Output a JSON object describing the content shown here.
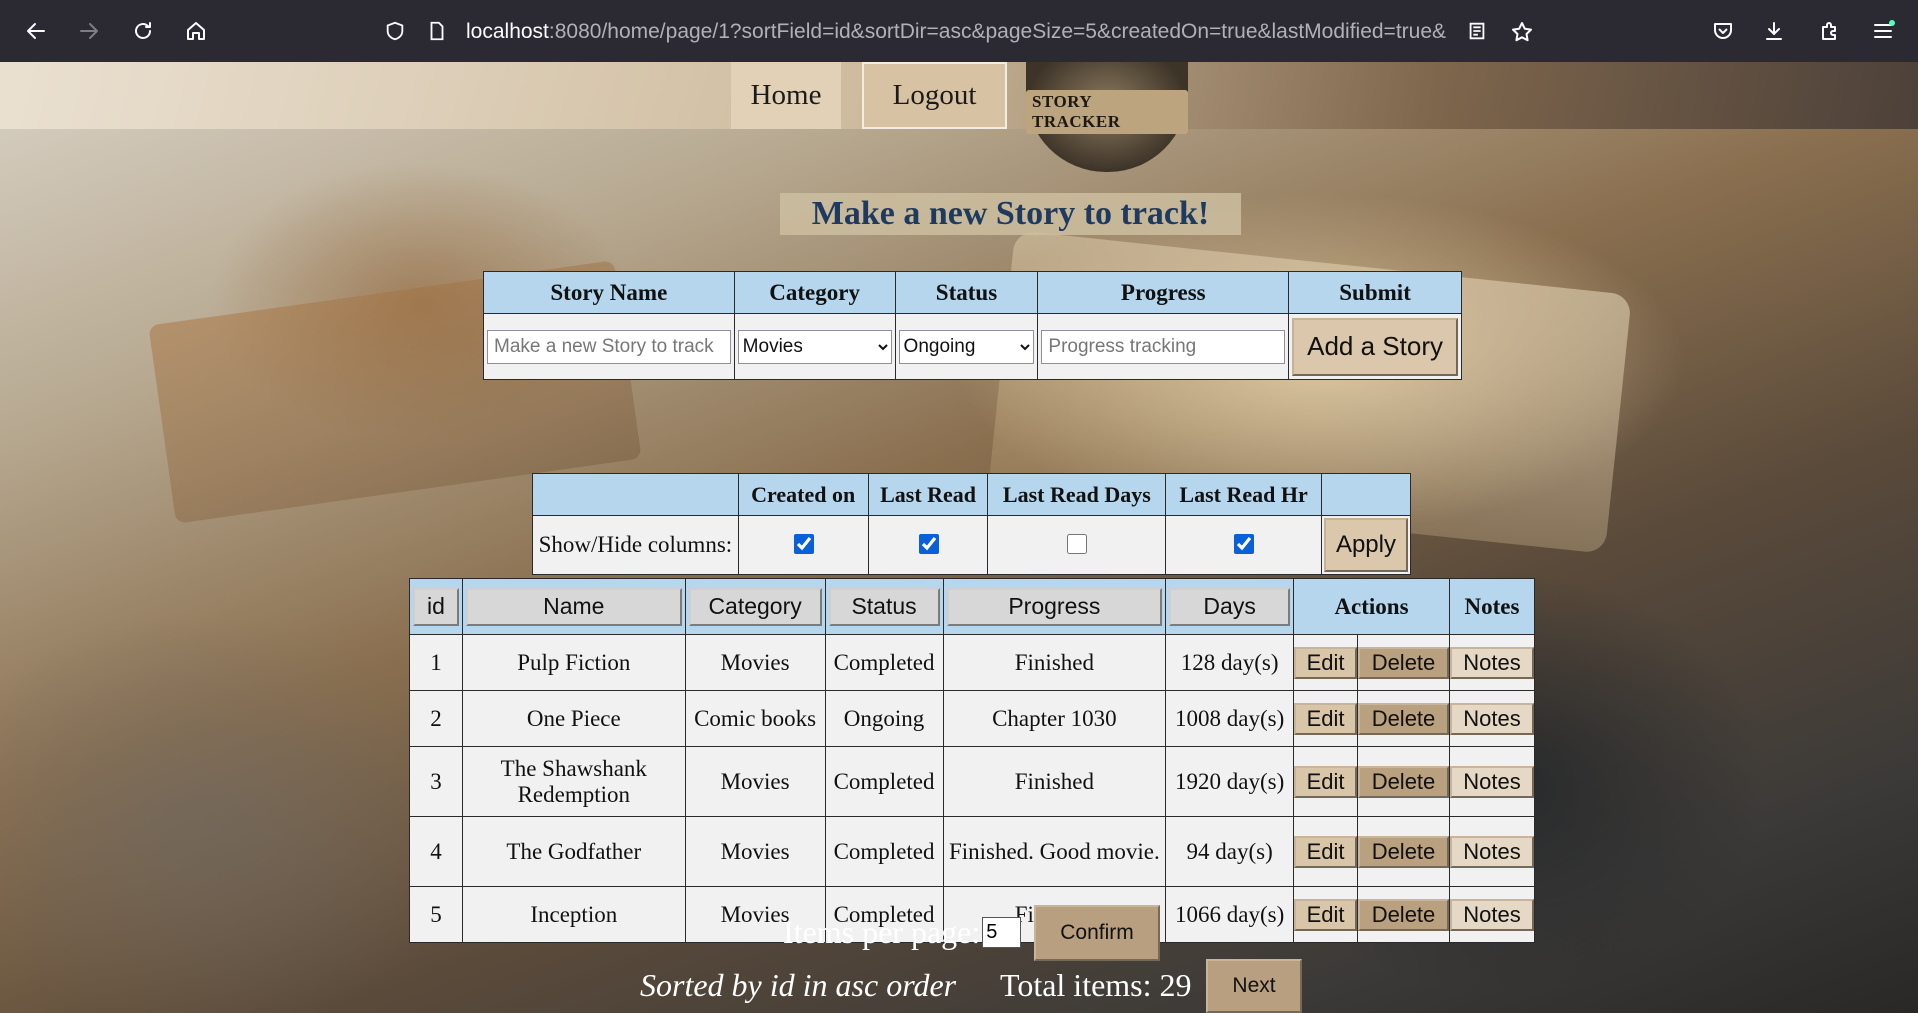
{
  "browser": {
    "url_host": "localhost",
    "url_path": ":8080/home/page/1?sortField=id&sortDir=asc&pageSize=5&createdOn=true&lastModified=true&"
  },
  "topbar": {
    "home_label": "Home",
    "logout_label": "Logout",
    "logo_text": "STORY TRACKER"
  },
  "heading": "Make a new Story to track!",
  "form": {
    "headers": [
      "Story Name",
      "Category",
      "Status",
      "Progress",
      "Submit"
    ],
    "name_placeholder": "Make a new Story to track",
    "category_value": "Movies",
    "status_value": "Ongoing",
    "progress_placeholder": "Progress tracking",
    "submit_label": "Add a Story"
  },
  "columns": {
    "headers": [
      "",
      "Created on",
      "Last Read",
      "Last Read Days",
      "Last Read Hr",
      ""
    ],
    "row_label": "Show/Hide columns:",
    "checked": [
      true,
      true,
      false,
      true
    ],
    "apply_label": "Apply"
  },
  "table": {
    "headers": {
      "id": "id",
      "name": "Name",
      "category": "Category",
      "status": "Status",
      "progress": "Progress",
      "days": "Days",
      "actions": "Actions",
      "notes": "Notes"
    },
    "edit_label": "Edit",
    "delete_label": "Delete",
    "notes_label": "Notes",
    "rows": [
      {
        "id": "1",
        "name": "Pulp Fiction",
        "category": "Movies",
        "status": "Completed",
        "progress": "Finished",
        "days": "128 day(s)"
      },
      {
        "id": "2",
        "name": "One Piece",
        "category": "Comic books",
        "status": "Ongoing",
        "progress": "Chapter 1030",
        "days": "1008 day(s)"
      },
      {
        "id": "3",
        "name": "The Shawshank Redemption",
        "category": "Movies",
        "status": "Completed",
        "progress": "Finished",
        "days": "1920 day(s)"
      },
      {
        "id": "4",
        "name": "The Godfather",
        "category": "Movies",
        "status": "Completed",
        "progress": "Finished. Good movie.",
        "days": "94 day(s)"
      },
      {
        "id": "5",
        "name": "Inception",
        "category": "Movies",
        "status": "Completed",
        "progress": "Finished",
        "days": "1066 day(s)"
      }
    ]
  },
  "footer": {
    "items_per_page_label": "Items per page:",
    "items_per_page_value": "5",
    "confirm_label": "Confirm",
    "sorted_text": "Sorted by id in asc order",
    "total_text": "Total items: 29",
    "next_label": "Next"
  }
}
